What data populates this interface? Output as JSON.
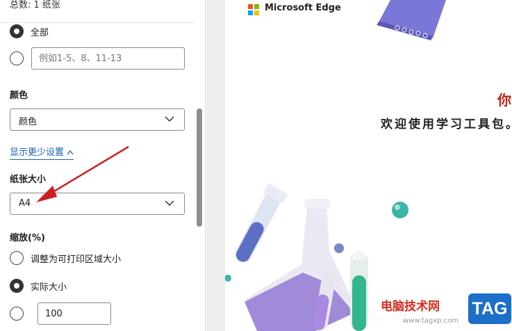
{
  "panel": {
    "total_label": "总数: 1 纸张",
    "pages": {
      "all_label": "全部",
      "custom_placeholder": "例如1-5、8、11-13"
    },
    "color": {
      "title": "颜色",
      "selected": "颜色"
    },
    "show_less_label": "显示更少设置",
    "paper_size": {
      "title": "纸张大小",
      "selected": "A4"
    },
    "scale": {
      "title": "缩放(%)",
      "fit_label": "调整为可打印区域大小",
      "actual_label": "实际大小",
      "custom_value": "100"
    }
  },
  "preview": {
    "brand": "Microsoft Edge",
    "headline": "你",
    "welcome": "欢迎使用学习工具包。",
    "watermark_text": "电脑技术网",
    "watermark_url": "www.tagxp.com",
    "watermark_tag": "TAG"
  },
  "colors": {
    "accent_link": "#1c5fb8",
    "arrow": "#cc1f1f",
    "headline": "#c0201a",
    "tag_bg": "#1d6fc9"
  }
}
